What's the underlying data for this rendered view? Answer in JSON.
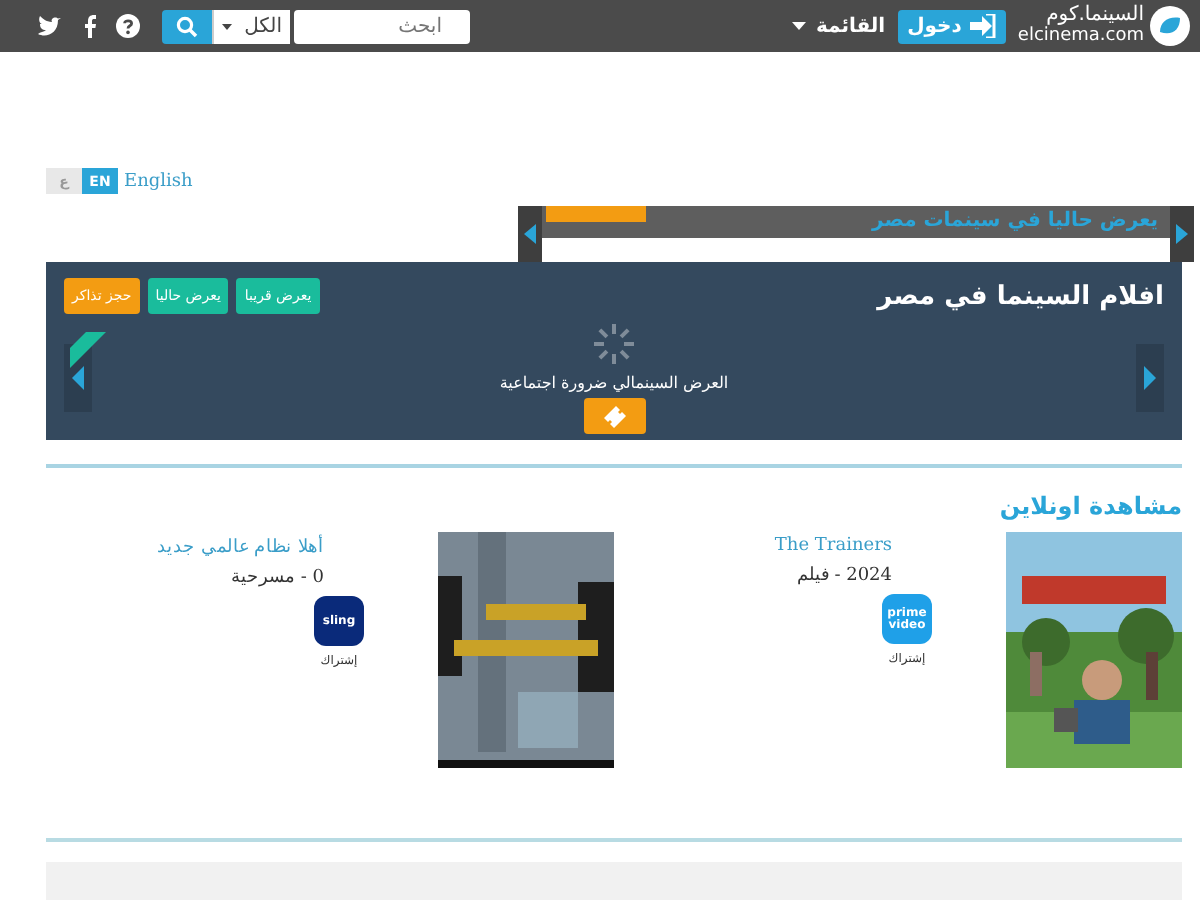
{
  "header": {
    "logo_arabic": "السينما.كوم",
    "logo_latin": "elcinema.com",
    "login": "دخول",
    "menu": "القائمة",
    "scope": "الكل",
    "search": {
      "placeholder": "ابحث"
    }
  },
  "language": {
    "options": [
      {
        "label": "EN",
        "selected": true
      },
      {
        "label": "ع",
        "selected": false
      }
    ],
    "link": "English"
  },
  "now_showing": {
    "title": "يعرض حاليا في سينمات مصر"
  },
  "cinema": {
    "title": "افلام السينما في مصر",
    "tabs": [
      {
        "label": "يعرض قريبا",
        "kind": "green"
      },
      {
        "label": "يعرض حاليا",
        "kind": "green"
      },
      {
        "label": "حجز تذاكر",
        "kind": "orange"
      }
    ],
    "message": "العرض السينمالي ضرورة اجتماعية"
  },
  "online": {
    "title": "مشاهدة اونلاين",
    "items": [
      {
        "title": "The Trainers",
        "meta": "2024 - فيلم",
        "provider": "prime video",
        "color": "#1fa0e8",
        "caption": "إشتراك"
      },
      {
        "title": "أهلا نظام عالمي جديد",
        "meta": "0 - مسرحية",
        "provider": "sling",
        "color": "#0a2a7a",
        "caption": "إشتراك"
      }
    ]
  }
}
